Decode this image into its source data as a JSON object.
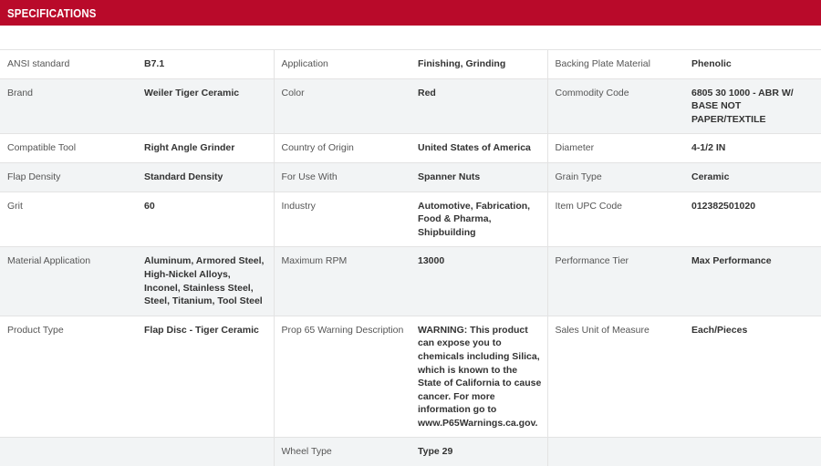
{
  "header": {
    "title": "SPECIFICATIONS"
  },
  "rows": [
    [
      {
        "label": "ANSI standard",
        "value": "B7.1"
      },
      {
        "label": "Application",
        "value": "Finishing, Grinding"
      },
      {
        "label": "Backing Plate Material",
        "value": "Phenolic"
      }
    ],
    [
      {
        "label": "Brand",
        "value": "Weiler Tiger Ceramic"
      },
      {
        "label": "Color",
        "value": "Red"
      },
      {
        "label": "Commodity Code",
        "value": "6805 30 1000 - ABR W/ BASE NOT PAPER/TEXTILE"
      }
    ],
    [
      {
        "label": "Compatible Tool",
        "value": "Right Angle Grinder"
      },
      {
        "label": "Country of Origin",
        "value": "United States of America"
      },
      {
        "label": "Diameter",
        "value": "4-1/2 IN"
      }
    ],
    [
      {
        "label": "Flap Density",
        "value": "Standard Density"
      },
      {
        "label": "For Use With",
        "value": "Spanner Nuts"
      },
      {
        "label": "Grain Type",
        "value": "Ceramic"
      }
    ],
    [
      {
        "label": "Grit",
        "value": "60"
      },
      {
        "label": "Industry",
        "value": "Automotive, Fabrication, Food & Pharma, Shipbuilding"
      },
      {
        "label": "Item UPC Code",
        "value": "012382501020"
      }
    ],
    [
      {
        "label": "Material Application",
        "value": "Aluminum, Armored Steel, High-Nickel Alloys, Inconel, Stainless Steel, Steel, Titanium, Tool Steel"
      },
      {
        "label": "Maximum RPM",
        "value": "13000"
      },
      {
        "label": "Performance Tier",
        "value": "Max Performance"
      }
    ],
    [
      {
        "label": "Product Type",
        "value": "Flap Disc - Tiger Ceramic"
      },
      {
        "label": "Prop 65 Warning Description",
        "value": "WARNING: This product can expose you to chemicals including Silica, which is known to the State of California to cause cancer. For more information go to www.P65Warnings.ca.gov."
      },
      {
        "label": "Sales Unit of Measure",
        "value": "Each/Pieces"
      }
    ],
    [
      {
        "label": "",
        "value": ""
      },
      {
        "label": "Wheel Type",
        "value": "Type 29"
      },
      {
        "label": "",
        "value": ""
      }
    ]
  ],
  "colors": {
    "header_bg": "#b90a2a",
    "row_alt_bg": "#f2f4f5",
    "border": "#e3e3e3"
  }
}
